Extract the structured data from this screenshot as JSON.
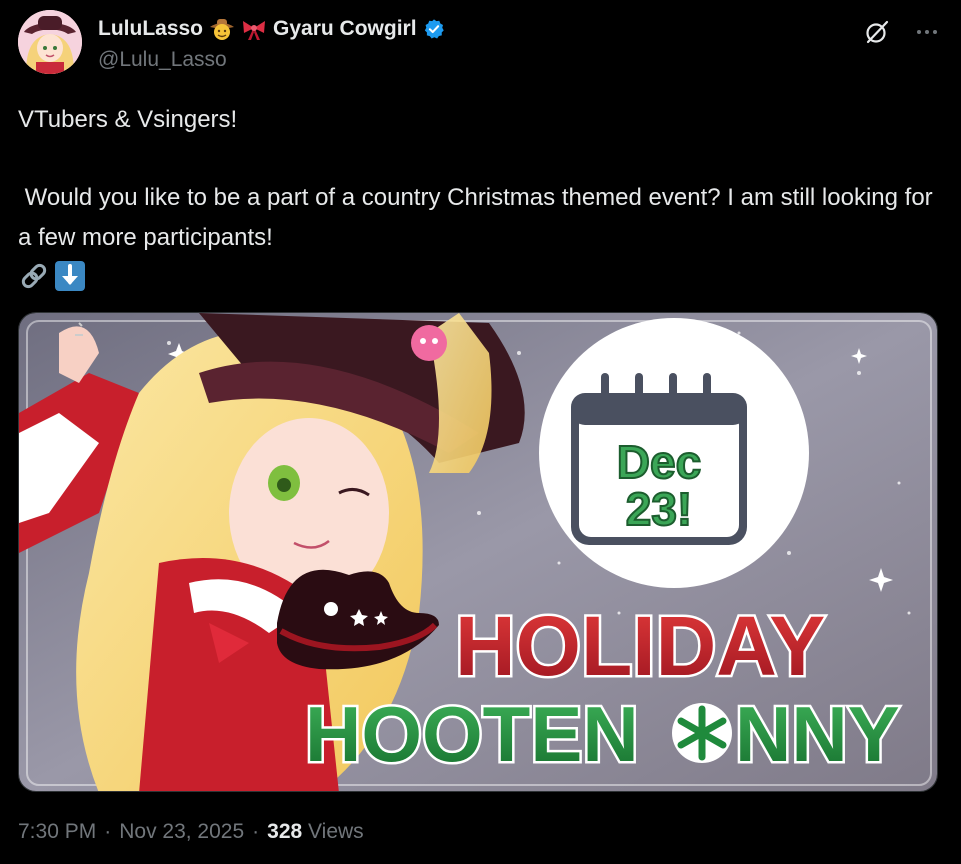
{
  "author": {
    "display_name": "LuluLasso",
    "name_suffix": "Gyaru Cowgirl",
    "handle": "@Lulu_Lasso"
  },
  "icons": {
    "verified": "verified-badge-icon",
    "grok": "grok-icon",
    "more": "more-options-icon",
    "cowboy": "cowboy-face-emoji",
    "ribbon": "ribbon-emoji",
    "link": "link-emoji",
    "down": "down-arrow-emoji"
  },
  "tweet": {
    "line1": "VTubers & Vsingers!",
    "line2": " Would you like to be a part of a country Christmas themed event? I am still looking for a few more participants!"
  },
  "media": {
    "date_line1": "Dec",
    "date_line2": "23!",
    "title_line1": "HOLIDAY",
    "title_line2": "HOOTEN",
    "title_line2b": "NNY"
  },
  "meta": {
    "time": "7:30 PM",
    "sep1": "·",
    "date": "Nov 23, 2025",
    "sep2": "·",
    "views_count": "328",
    "views_label": "Views"
  },
  "colors": {
    "background": "#000000",
    "text": "#e7e9ea",
    "muted": "#71767b",
    "verified": "#1d9bf0",
    "holiday_red": "#c0202a",
    "holiday_green": "#1f8a3c"
  }
}
